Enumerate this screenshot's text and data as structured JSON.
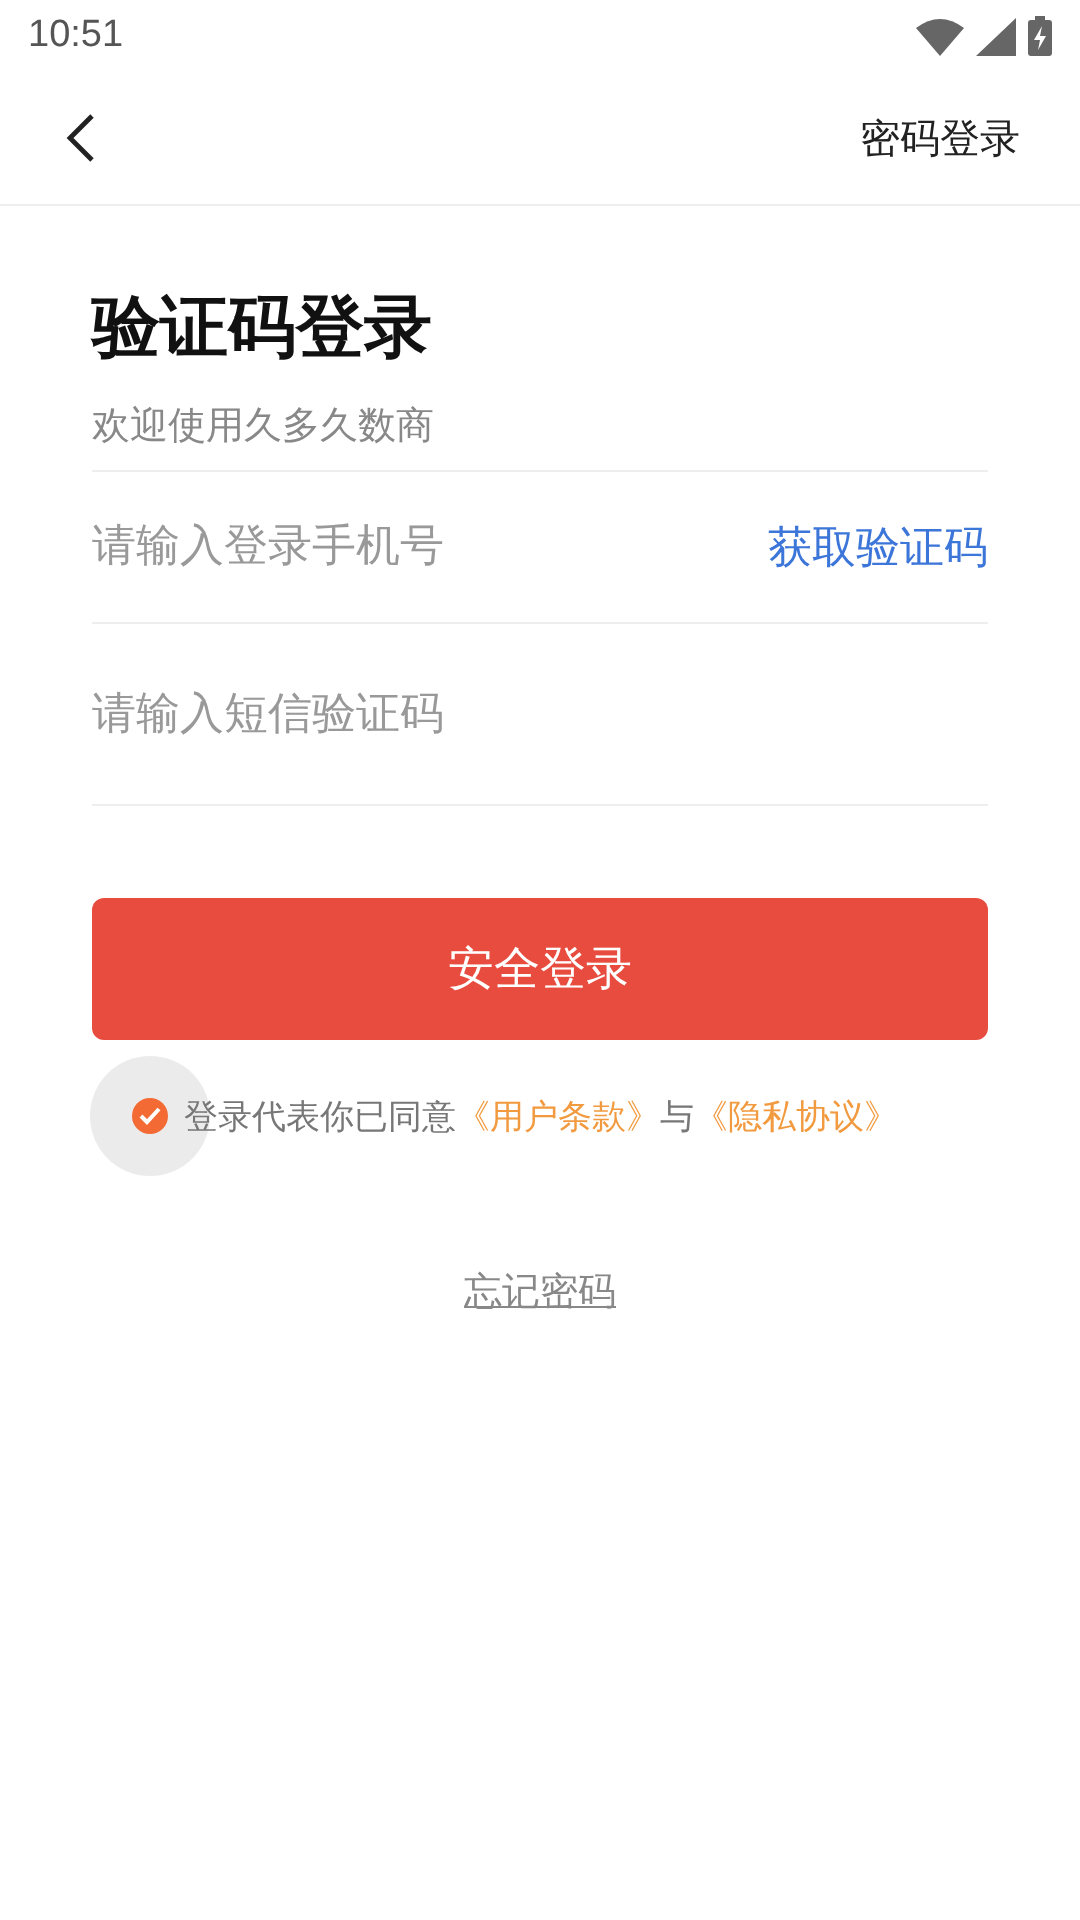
{
  "status_bar": {
    "time": "10:51"
  },
  "header": {
    "action": "密码登录"
  },
  "title": "验证码登录",
  "subtitle": "欢迎使用久多久数商",
  "phone_field": {
    "placeholder": "请输入登录手机号"
  },
  "get_code_button": "获取验证码",
  "code_field": {
    "placeholder": "请输入短信验证码"
  },
  "login_button": "安全登录",
  "agreement": {
    "checked": true,
    "text": "登录代表你已同意",
    "terms_link": "《用户条款》",
    "conjunction": "与",
    "privacy_link": "《隐私协议》"
  },
  "forgot_password": "忘记密码"
}
